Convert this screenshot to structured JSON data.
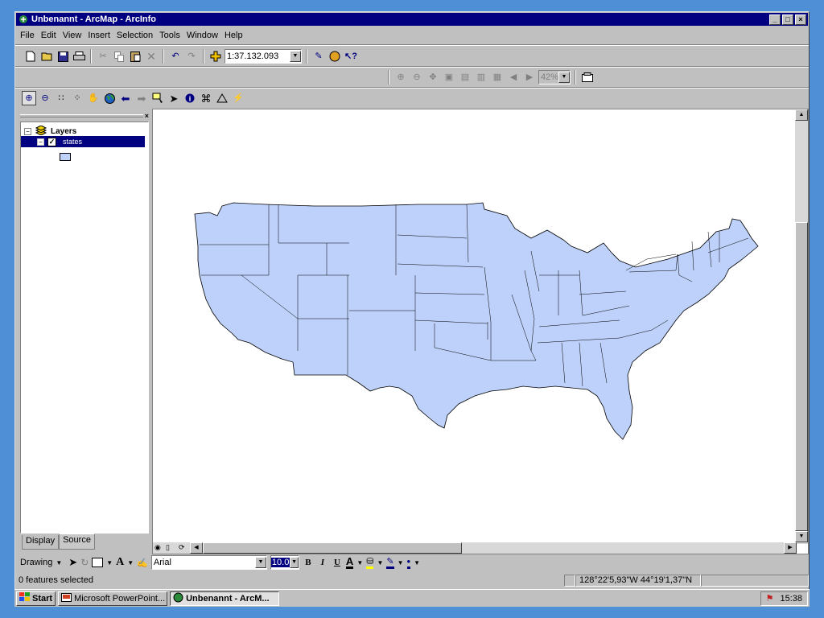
{
  "window": {
    "title": "Unbenannt - ArcMap - ArcInfo",
    "min": "_",
    "max": "□",
    "close": "×"
  },
  "menu": {
    "items": [
      "File",
      "Edit",
      "View",
      "Insert",
      "Selection",
      "Tools",
      "Window",
      "Help"
    ]
  },
  "toolbar": {
    "scale": "1:37.132.093",
    "zoom_pct": "42%"
  },
  "toc": {
    "root_label": "Layers",
    "layer_label": "states"
  },
  "tabs": {
    "display": "Display",
    "source": "Source"
  },
  "drawing": {
    "label": "Drawing",
    "font": "Arial",
    "size": "10.0",
    "bold": "B",
    "italic": "I",
    "underline": "U",
    "font_color": "A"
  },
  "status": {
    "selected": "0 features selected",
    "coords": "128°22'5,93\"W  44°19'1,37\"N"
  },
  "taskbar": {
    "start": "Start",
    "task1": "Microsoft PowerPoint...",
    "task2": "Unbenannt - ArcM...",
    "time": "15:38"
  },
  "colors": {
    "map_fill": "#bdd1fa",
    "title_bg": "#000080",
    "desktop": "#4f8fd6"
  }
}
